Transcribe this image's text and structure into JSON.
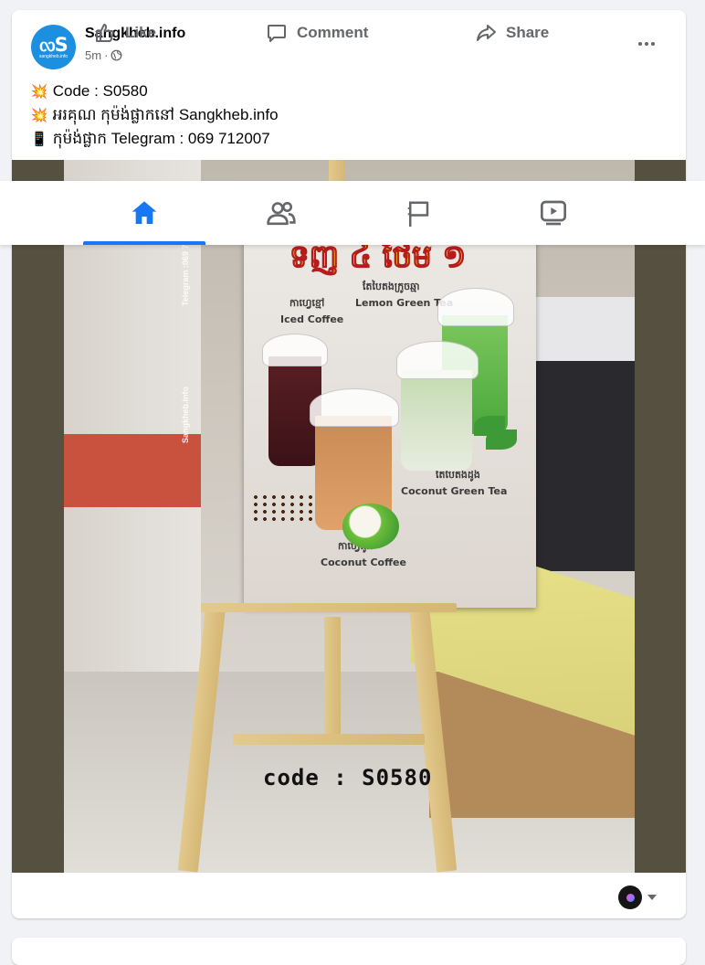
{
  "post": {
    "page_name": "Sangkheb.info",
    "avatar_text": "ᦟS",
    "avatar_subtext": "sangkheb.info",
    "time": "5m",
    "separator": "·",
    "lines": [
      {
        "emoji": "💥",
        "text": "Code : S0580"
      },
      {
        "emoji": "💥",
        "text": "អរគុណ កុម៉ង់ផ្លាកនៅ Sangkheb.info"
      },
      {
        "emoji": "📱",
        "text": "កុម៉ង់ផ្លាក Telegram : 069 712007"
      }
    ]
  },
  "photo": {
    "poster_title": "ទិញ ៤ ថែម ១",
    "labels": {
      "iced_coffee_kh": "កាហ្វេខ្មៅ",
      "iced_coffee": "Iced Coffee",
      "lemon_tea_kh": "តែបៃតងក្រូចឆ្មា",
      "lemon_tea": "Lemon Green Tea",
      "coconut_tea_kh": "តែបៃតងដូង",
      "coconut_tea": "Coconut Green Tea",
      "coconut_coffee_kh": "កាហ្វេដូង",
      "coconut_coffee": "Coconut Coffee"
    },
    "watermark_main": "Sangkheb.info",
    "watermark_tel": "Telegram :069 7",
    "code_text": "code : S0580"
  },
  "tabs": [
    {
      "name": "home",
      "icon": "home-icon",
      "active": true
    },
    {
      "name": "friends",
      "icon": "friends-icon",
      "active": false
    },
    {
      "name": "pages",
      "icon": "flag-icon",
      "active": false
    },
    {
      "name": "watch",
      "icon": "video-icon",
      "active": false
    }
  ],
  "actions": {
    "like": "Like",
    "comment": "Comment",
    "share": "Share"
  },
  "colors": {
    "accent": "#1877f2",
    "secondary_text": "#65676b",
    "background": "#f0f2f5"
  }
}
